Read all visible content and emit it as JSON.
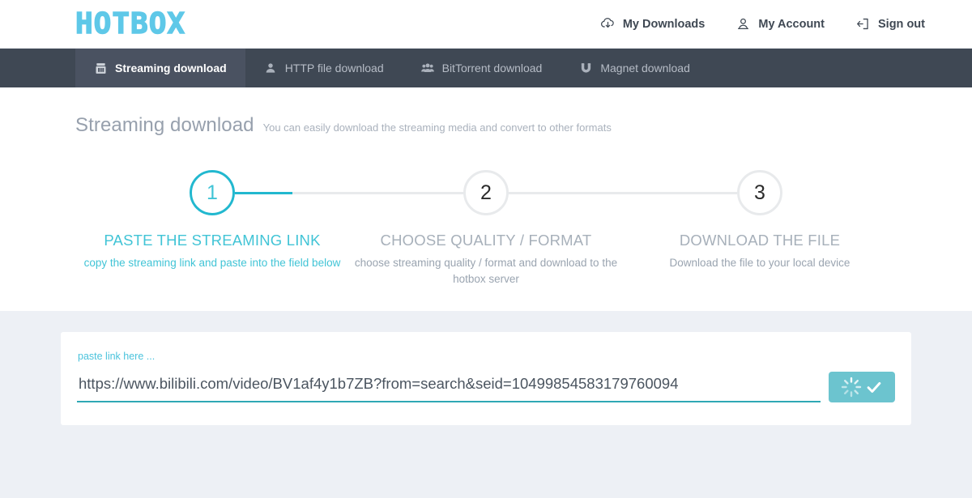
{
  "brand": {
    "logo": "HOTBOX",
    "accent": "#5ec8e8"
  },
  "header": {
    "links": [
      {
        "label": "My Downloads",
        "icon": "cloud-download-icon"
      },
      {
        "label": "My Account",
        "icon": "user-icon"
      },
      {
        "label": "Sign out",
        "icon": "sign-out-icon"
      }
    ]
  },
  "tabs": [
    {
      "label": "Streaming download",
      "icon": "streaming-icon",
      "active": true
    },
    {
      "label": "HTTP file download",
      "icon": "user-icon",
      "active": false
    },
    {
      "label": "BitTorrent download",
      "icon": "users-group-icon",
      "active": false
    },
    {
      "label": "Magnet download",
      "icon": "magnet-icon",
      "active": false
    }
  ],
  "page": {
    "title": "Streaming download",
    "subtitle": "You can easily download the streaming media and convert to other formats"
  },
  "steps": [
    {
      "number": "1",
      "label": "PASTE THE STREAMING LINK",
      "desc": "copy the streaming link and paste into the field below",
      "active": true,
      "progress_percent": 50
    },
    {
      "number": "2",
      "label": "CHOOSE QUALITY / FORMAT",
      "desc": "choose streaming quality / format and download to the hotbox server",
      "active": false,
      "progress_percent": 0
    },
    {
      "number": "3",
      "label": "DOWNLOAD THE FILE",
      "desc": "Download the file to your local device",
      "active": false,
      "progress_percent": 0
    }
  ],
  "form": {
    "paste_label": "paste link here ...",
    "input_value": "https://www.bilibili.com/video/BV1af4y1b7ZB?from=search&seid=10499854583179760094",
    "input_placeholder": "paste link here ...",
    "submit_icons": [
      "loading-spinner-icon",
      "check-icon"
    ],
    "submit_color": "#6cc4cf"
  },
  "colors": {
    "accent_cyan": "#22b8cf",
    "navbar_dark": "#3f4854",
    "navbar_active": "#4a5261",
    "page_bg": "#edf0f5"
  }
}
